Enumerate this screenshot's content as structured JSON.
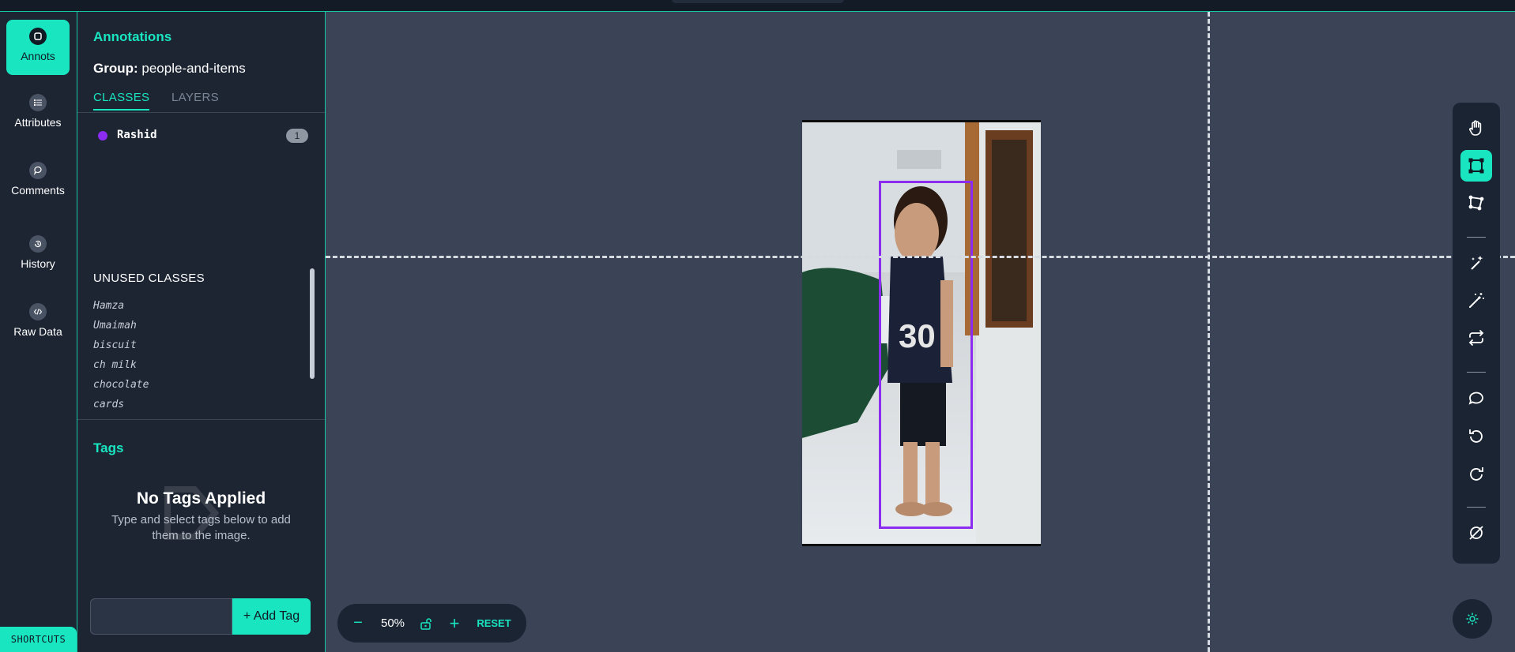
{
  "nav": {
    "items": [
      {
        "label": "Annots",
        "icon": "annotation-icon",
        "active": true
      },
      {
        "label": "Attributes",
        "icon": "list-icon"
      },
      {
        "label": "Comments",
        "icon": "comment-icon"
      },
      {
        "label": "History",
        "icon": "history-icon"
      },
      {
        "label": "Raw Data",
        "icon": "code-icon"
      }
    ],
    "shortcuts_label": "SHORTCUTS"
  },
  "panel": {
    "title": "Annotations",
    "group_prefix": "Group:",
    "group_name": "people-and-items",
    "tabs": [
      "CLASSES",
      "LAYERS"
    ],
    "classes": [
      {
        "name": "Rashid",
        "count": "1",
        "color": "#8b2cf0"
      }
    ],
    "unused_title": "UNUSED CLASSES",
    "unused": [
      "Hamza",
      "Umaimah",
      "biscuit",
      "ch milk",
      "chocolate",
      "cards"
    ]
  },
  "tags": {
    "title": "Tags",
    "empty_title": "No Tags Applied",
    "empty_desc": "Type and select tags below to add them to the image.",
    "input_placeholder": "",
    "add_label": "+ Add Tag"
  },
  "zoom": {
    "minus": "−",
    "value": "50%",
    "plus": "+",
    "reset": "RESET"
  },
  "toolbar": {
    "tools": [
      "hand-icon",
      "bounding-box-icon",
      "polygon-icon",
      "auto-segment-icon",
      "magic-wand-icon",
      "repeat-icon",
      "comment-icon",
      "undo-icon",
      "redo-icon",
      "hide-icon"
    ],
    "active": "bounding-box-icon"
  },
  "colors": {
    "accent": "#19e6c1",
    "annotation": "#8b2cf0",
    "canvas": "#3a4456",
    "panel": "#1d2533"
  }
}
